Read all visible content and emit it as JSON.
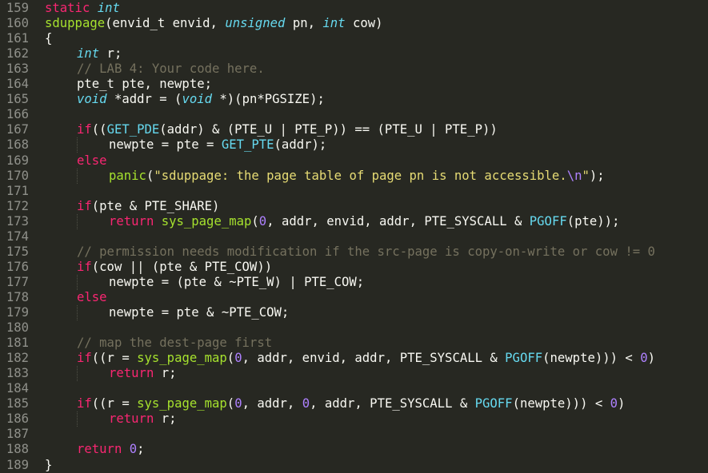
{
  "editor": {
    "colors": {
      "background": "#272822",
      "gutter_text": "#8f908a",
      "text": "#f8f8f2",
      "keyword": "#f92672",
      "type": "#66d9ef",
      "function": "#a6e22e",
      "number": "#ae81ff",
      "string": "#e6db74",
      "comment": "#75715e"
    },
    "lines": [
      {
        "num": "159",
        "indent": 0,
        "tokens": [
          [
            "kw",
            "static"
          ],
          [
            "",
            " "
          ],
          [
            "ty",
            "int"
          ]
        ]
      },
      {
        "num": "160",
        "indent": 0,
        "tokens": [
          [
            "fn",
            "sduppage"
          ],
          [
            "",
            "(envid_t envid, "
          ],
          [
            "ty",
            "unsigned"
          ],
          [
            "",
            " pn, "
          ],
          [
            "ty",
            "int"
          ],
          [
            "",
            " cow)"
          ]
        ]
      },
      {
        "num": "161",
        "indent": 0,
        "tokens": [
          [
            "",
            "{"
          ]
        ]
      },
      {
        "num": "162",
        "indent": 1,
        "tokens": [
          [
            "ty",
            "int"
          ],
          [
            "",
            " r;"
          ]
        ]
      },
      {
        "num": "163",
        "indent": 1,
        "tokens": [
          [
            "com",
            "// LAB 4: Your code here."
          ]
        ]
      },
      {
        "num": "164",
        "indent": 1,
        "tokens": [
          [
            "",
            "pte_t pte, newpte;"
          ]
        ]
      },
      {
        "num": "165",
        "indent": 1,
        "tokens": [
          [
            "ty",
            "void"
          ],
          [
            "",
            " *addr = ("
          ],
          [
            "ty",
            "void"
          ],
          [
            "",
            " *)(pn*PGSIZE);"
          ]
        ]
      },
      {
        "num": "166",
        "indent": 1,
        "tokens": []
      },
      {
        "num": "167",
        "indent": 1,
        "tokens": [
          [
            "kw",
            "if"
          ],
          [
            "",
            "(("
          ],
          [
            "mac",
            "GET_PDE"
          ],
          [
            "",
            "(addr) & (PTE_U | PTE_P)) == (PTE_U | PTE_P))"
          ]
        ]
      },
      {
        "num": "168",
        "indent": 2,
        "tokens": [
          [
            "",
            "newpte = pte = "
          ],
          [
            "mac",
            "GET_PTE"
          ],
          [
            "",
            "(addr);"
          ]
        ]
      },
      {
        "num": "169",
        "indent": 1,
        "tokens": [
          [
            "kw",
            "else"
          ]
        ]
      },
      {
        "num": "170",
        "indent": 2,
        "tokens": [
          [
            "fn",
            "panic"
          ],
          [
            "",
            "("
          ],
          [
            "str",
            "\"sduppage: the page table of page pn is not accessible."
          ],
          [
            "esc",
            "\\n"
          ],
          [
            "str",
            "\""
          ],
          [
            "",
            ");"
          ]
        ]
      },
      {
        "num": "171",
        "indent": 1,
        "tokens": []
      },
      {
        "num": "172",
        "indent": 1,
        "tokens": [
          [
            "kw",
            "if"
          ],
          [
            "",
            "(pte & PTE_SHARE)"
          ]
        ]
      },
      {
        "num": "173",
        "indent": 2,
        "tokens": [
          [
            "kw",
            "return"
          ],
          [
            "",
            ""
          ],
          [
            "fn",
            " sys_page_map"
          ],
          [
            "",
            "("
          ],
          [
            "num",
            "0"
          ],
          [
            "",
            ", addr, envid, addr, PTE_SYSCALL & "
          ],
          [
            "mac",
            "PGOFF"
          ],
          [
            "",
            "(pte));"
          ]
        ]
      },
      {
        "num": "174",
        "indent": 1,
        "tokens": []
      },
      {
        "num": "175",
        "indent": 1,
        "tokens": [
          [
            "com",
            "// permission needs modification if the src-page is copy-on-write or cow != 0"
          ]
        ]
      },
      {
        "num": "176",
        "indent": 1,
        "tokens": [
          [
            "kw",
            "if"
          ],
          [
            "",
            "(cow || (pte & PTE_COW))"
          ]
        ]
      },
      {
        "num": "177",
        "indent": 2,
        "tokens": [
          [
            "",
            "newpte = (pte & ~PTE_W) | PTE_COW;"
          ]
        ]
      },
      {
        "num": "178",
        "indent": 1,
        "tokens": [
          [
            "kw",
            "else"
          ]
        ]
      },
      {
        "num": "179",
        "indent": 2,
        "tokens": [
          [
            "",
            "newpte = pte & ~PTE_COW;"
          ]
        ]
      },
      {
        "num": "180",
        "indent": 1,
        "tokens": []
      },
      {
        "num": "181",
        "indent": 1,
        "tokens": [
          [
            "com",
            "// map the dest-page first"
          ]
        ]
      },
      {
        "num": "182",
        "indent": 1,
        "tokens": [
          [
            "kw",
            "if"
          ],
          [
            "",
            "((r = "
          ],
          [
            "fn",
            "sys_page_map"
          ],
          [
            "",
            "("
          ],
          [
            "num",
            "0"
          ],
          [
            "",
            ", addr, envid, addr, PTE_SYSCALL & "
          ],
          [
            "mac",
            "PGOFF"
          ],
          [
            "",
            "(newpte))) < "
          ],
          [
            "num",
            "0"
          ],
          [
            "",
            ")"
          ]
        ]
      },
      {
        "num": "183",
        "indent": 2,
        "tokens": [
          [
            "kw",
            "return"
          ],
          [
            "",
            " r;"
          ]
        ]
      },
      {
        "num": "184",
        "indent": 1,
        "tokens": []
      },
      {
        "num": "185",
        "indent": 1,
        "tokens": [
          [
            "kw",
            "if"
          ],
          [
            "",
            "((r = "
          ],
          [
            "fn",
            "sys_page_map"
          ],
          [
            "",
            "("
          ],
          [
            "num",
            "0"
          ],
          [
            "",
            ", addr, "
          ],
          [
            "num",
            "0"
          ],
          [
            "",
            ", addr, PTE_SYSCALL & "
          ],
          [
            "mac",
            "PGOFF"
          ],
          [
            "",
            "(newpte))) < "
          ],
          [
            "num",
            "0"
          ],
          [
            "",
            ")"
          ]
        ]
      },
      {
        "num": "186",
        "indent": 2,
        "tokens": [
          [
            "kw",
            "return"
          ],
          [
            "",
            " r;"
          ]
        ]
      },
      {
        "num": "187",
        "indent": 1,
        "tokens": []
      },
      {
        "num": "188",
        "indent": 1,
        "tokens": [
          [
            "kw",
            "return"
          ],
          [
            "",
            ""
          ],
          [
            "num",
            " 0"
          ],
          [
            "",
            ";"
          ]
        ]
      },
      {
        "num": "189",
        "indent": 0,
        "tokens": [
          [
            "",
            "}"
          ]
        ]
      }
    ]
  }
}
